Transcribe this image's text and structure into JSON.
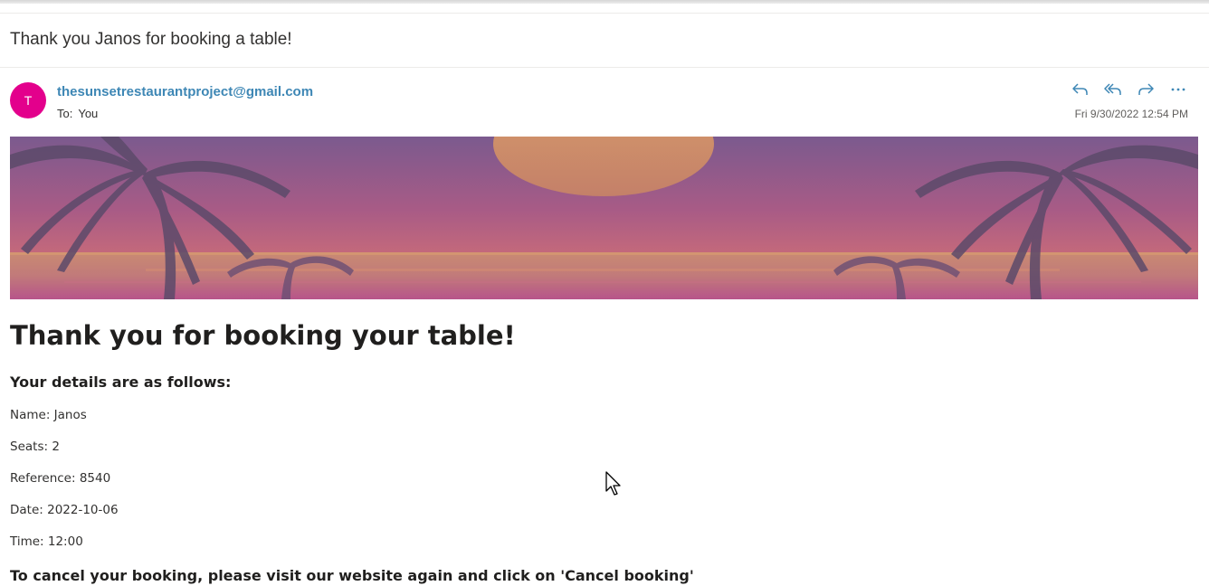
{
  "email": {
    "subject": "Thank you Janos for booking a table!",
    "sender_initial": "T",
    "sender": "thesunsetrestaurantproject@gmail.com",
    "to_label": "To:",
    "to_value": "You",
    "timestamp": "Fri 9/30/2022 12:54 PM",
    "avatar_color": "#e3008c",
    "actions": [
      {
        "name": "reply",
        "icon": "reply-icon"
      },
      {
        "name": "reply-all",
        "icon": "reply-all-icon"
      },
      {
        "name": "forward",
        "icon": "forward-icon"
      },
      {
        "name": "more-actions",
        "icon": "more-icon"
      }
    ]
  },
  "body": {
    "banner_image": "sunset-palm-trees-banner",
    "headline": "Thank you for booking your table!",
    "subhead": "Your details are as follows:",
    "details": [
      "Name: Janos",
      "Seats: 2",
      "Reference: 8540",
      "Date: 2022-10-06",
      "Time: 12:00"
    ],
    "cancel_note": "To cancel your booking, please visit our website again and click on 'Cancel booking'"
  },
  "colors": {
    "sender_link": "#3e87b5",
    "action_icon": "#3e87b5"
  }
}
